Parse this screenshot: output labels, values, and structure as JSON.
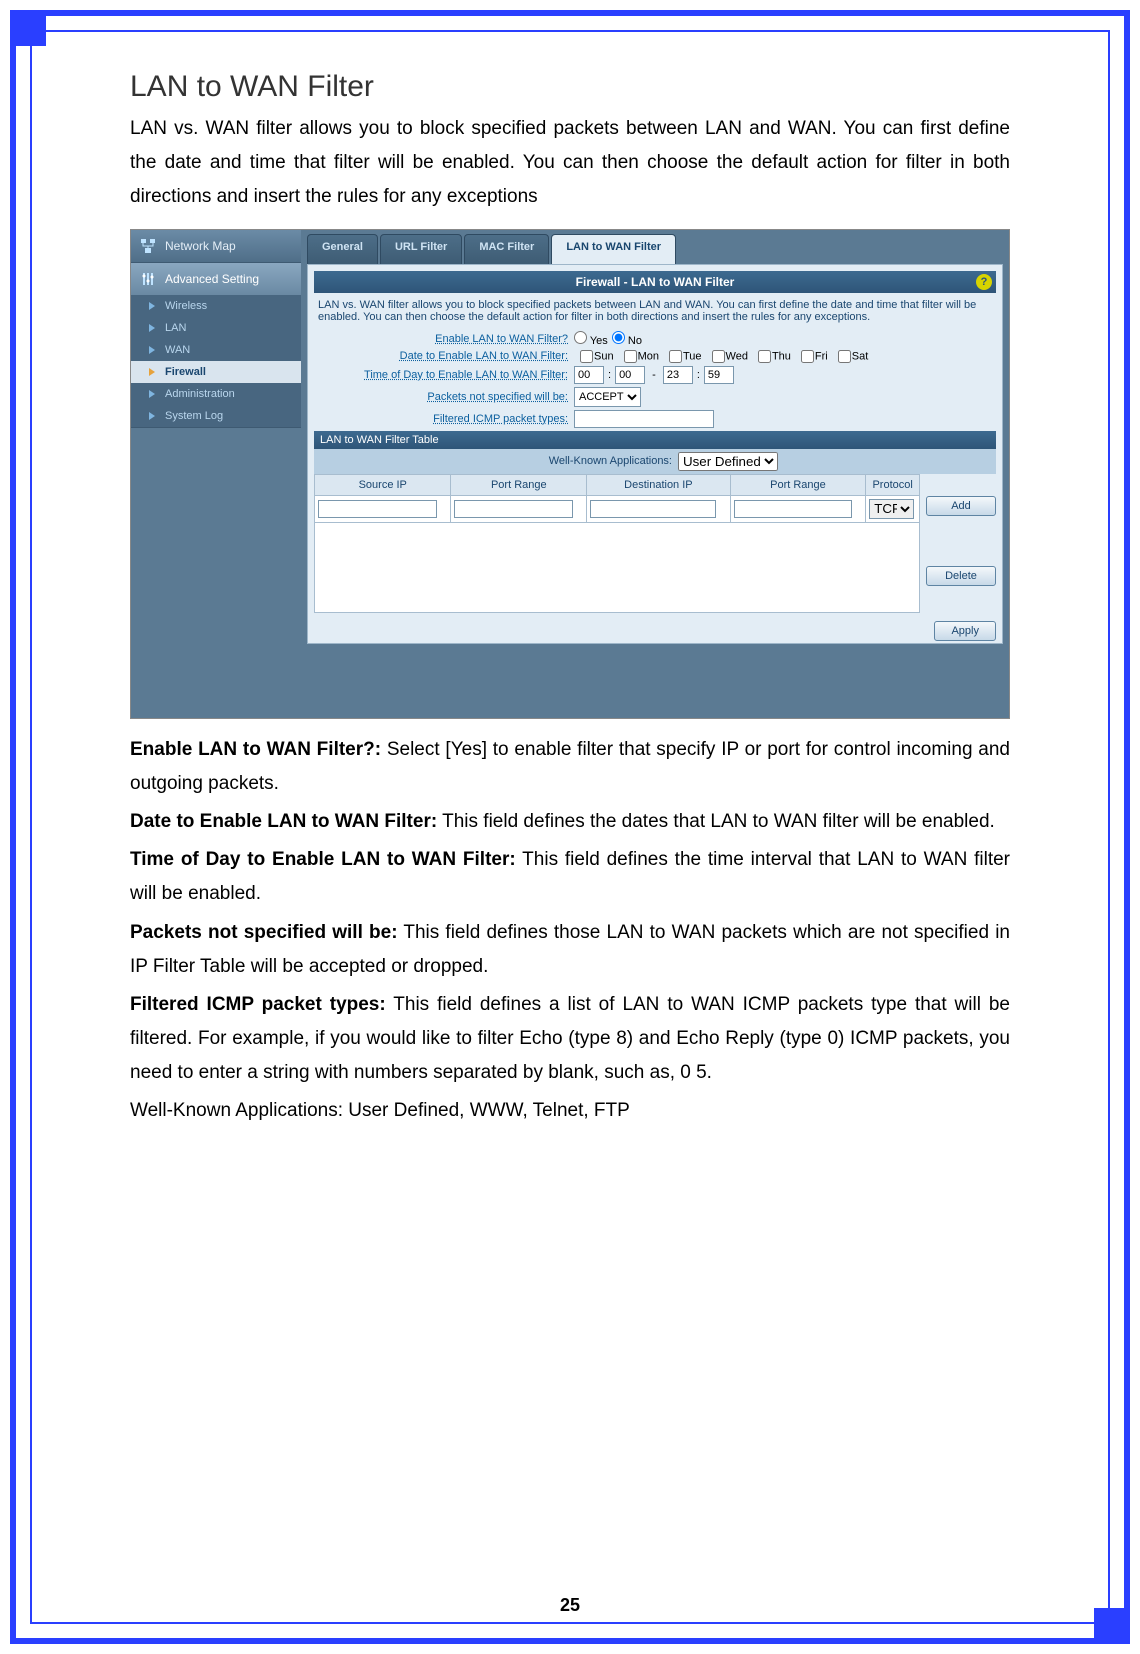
{
  "title": "LAN to WAN Filter",
  "intro": "LAN vs. WAN filter allows you to block specified packets between LAN and WAN. You can first define the date and time that filter will be enabled. You can then choose the default action for filter in both directions and insert the rules for any exceptions",
  "sidebar": {
    "network_map": "Network Map",
    "advanced_setting": "Advanced Setting",
    "items": [
      {
        "label": "Wireless"
      },
      {
        "label": "LAN"
      },
      {
        "label": "WAN"
      },
      {
        "label": "Firewall"
      },
      {
        "label": "Administration"
      },
      {
        "label": "System Log"
      }
    ]
  },
  "tabs": {
    "general": "General",
    "url_filter": "URL Filter",
    "mac_filter": "MAC Filter",
    "lan_to_wan": "LAN to WAN Filter"
  },
  "panel": {
    "title": "Firewall - LAN to WAN Filter",
    "help": "?",
    "description": "LAN vs. WAN filter allows you to block specified packets between LAN and WAN. You can first define the date and time that filter will be enabled. You can then choose the default action for filter in both directions and insert the rules for any exceptions.",
    "labels": {
      "enable": "Enable LAN to WAN Filter?",
      "date_enable": "Date to Enable LAN to WAN Filter:",
      "time_enable": "Time of Day to Enable LAN to WAN Filter:",
      "packets_default": "Packets not specified will be:",
      "icmp_types": "Filtered ICMP packet types:"
    },
    "values": {
      "yes": "Yes",
      "no": "No",
      "days": [
        "Sun",
        "Mon",
        "Tue",
        "Wed",
        "Thu",
        "Fri",
        "Sat"
      ],
      "time_h1": "00",
      "time_m1": "00",
      "time_h2": "23",
      "time_m2": "59",
      "packets_default": "ACCEPT",
      "icmp_types": ""
    },
    "table": {
      "title": "LAN to WAN Filter Table",
      "wka_label": "Well-Known Applications:",
      "wka_value": "User Defined",
      "headers": {
        "source_ip": "Source IP",
        "port_range1": "Port Range",
        "dest_ip": "Destination IP",
        "port_range2": "Port Range",
        "protocol": "Protocol"
      },
      "protocol_value": "TCP"
    },
    "buttons": {
      "add": "Add",
      "delete": "Delete",
      "apply": "Apply"
    }
  },
  "descriptions": {
    "enable_label": "Enable LAN to WAN Filter?:",
    "enable_text": " Select [Yes] to enable filter that specify IP or port for control incoming and outgoing packets.",
    "date_label": "Date to Enable LAN to WAN Filter:",
    "date_text": " This field defines the dates that LAN to WAN filter will be enabled.",
    "time_label": "Time of Day to Enable LAN to WAN Filter:",
    "time_text": " This field defines the time interval that LAN to WAN filter will be enabled.",
    "packets_label": "Packets not specified will be:",
    "packets_text": " This field defines those LAN to WAN packets which are not specified in IP Filter Table will be accepted or dropped.",
    "icmp_label": "Filtered ICMP packet types:",
    "icmp_text": " This field defines a list of LAN to WAN ICMP packets type that will be filtered. For example, if you would like to filter Echo (type 8) and Echo Reply (type 0) ICMP packets, you need to enter a string with numbers separated by blank, such as, 0 5.",
    "wka_text": "Well-Known Applications: User Defined, WWW, Telnet, FTP"
  },
  "page_number": "25"
}
